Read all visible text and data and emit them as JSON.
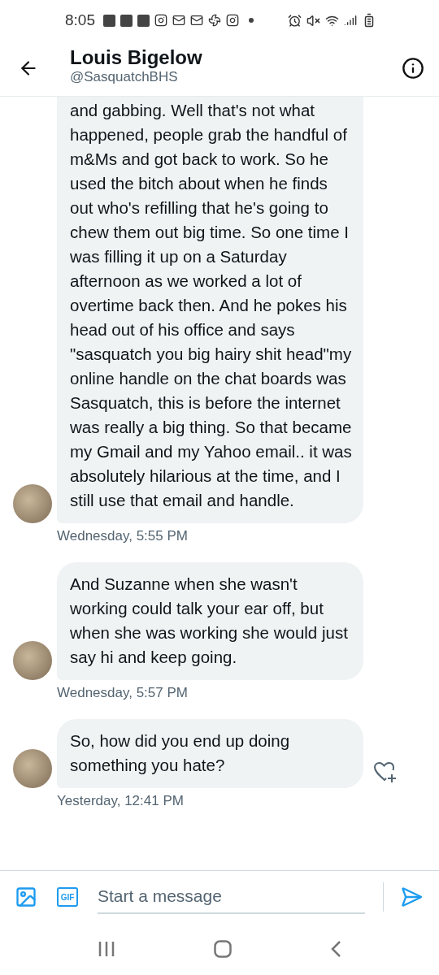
{
  "status_bar": {
    "time": "8:05"
  },
  "header": {
    "name": "Louis Bigelow",
    "handle": "@SasquatchBHS"
  },
  "messages": [
    {
      "text": "and gabbing. Well that's not what happened, people grab the handful of m&Ms and got back to work. So he used the bitch about when he finds out who's refilling that he's going to chew them out big time. So one time I was filling it up on a Saturday afternoon as we worked a lot of overtime back then. And he pokes his head out of his office and says \"sasquatch you big hairy shit head\"my online handle on the chat boards was Sasquatch, this is before the internet was really a big thing. So that became my Gmail and my Yahoo email.. it was absolutely hilarious at the time, and I still use that email and handle.",
      "time": "Wednesday, 5:55 PM",
      "react_button": false
    },
    {
      "text": "And Suzanne when she wasn't working could talk your ear off, but when she was working she would just say hi and keep going.",
      "time": "Wednesday, 5:57 PM",
      "react_button": false
    },
    {
      "text": "So, how did you end up doing something you hate?",
      "time": "Yesterday, 12:41 PM",
      "react_button": true
    }
  ],
  "composer": {
    "gif_label": "GIF",
    "placeholder": "Start a message"
  }
}
